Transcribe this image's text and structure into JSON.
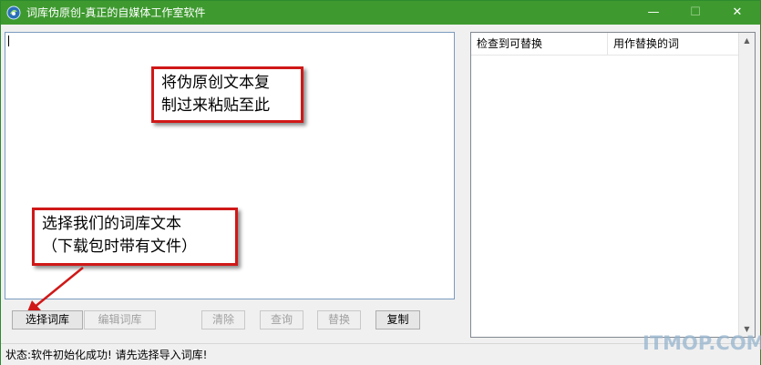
{
  "window": {
    "title": "词库伪原创-真正的自媒体工作室软件",
    "minimize_glyph": "—",
    "maximize_glyph": "☐",
    "close_glyph": "✕",
    "titlebar_color": "#3e9a2f"
  },
  "callouts": {
    "paste": [
      "将伪原创文本复",
      "制过来粘贴至此"
    ],
    "select": [
      "选择我们的词库文本",
      "（下载包时带有文件）"
    ],
    "border_color": "#d01818"
  },
  "buttons": {
    "select_dict": "选择词库",
    "edit_dict": "编辑词库",
    "clear": "清除",
    "query": "查询",
    "replace": "替换",
    "copy": "复制"
  },
  "listview": {
    "columns": [
      "检查到可替换",
      "用作替换的词"
    ],
    "scroll_up_glyph": "▲",
    "scroll_down_glyph": "▼"
  },
  "status": {
    "text": "状态:软件初始化成功! 请先选择导入词库!"
  },
  "watermark": "ITMOP.COM"
}
